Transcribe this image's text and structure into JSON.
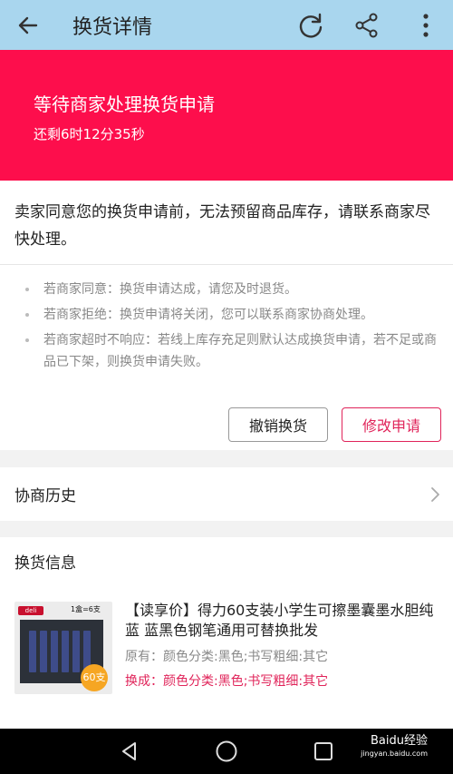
{
  "appbar": {
    "title": "换货详情",
    "icons": [
      "back-arrow-icon",
      "refresh-icon",
      "share-icon",
      "more-vert-icon"
    ]
  },
  "banner": {
    "status": "等待商家处理换货申请",
    "countdown": "还剩6时12分35秒",
    "color": "#fd0e4c"
  },
  "notice": {
    "message": "卖家同意您的换货申请前，无法预留商品库存，请联系商家尽快处理。",
    "rules": [
      "若商家同意：换货申请达成，请您及时退货。",
      "若商家拒绝：换货申请将关闭，您可以联系商家协商处理。",
      "若商家超时不响应：若线上库存充足则默认达成换货申请，若不足或商品已下架，则换货申请失败。"
    ],
    "buttons": {
      "cancel": "撤销换货",
      "modify": "修改申请"
    }
  },
  "history": {
    "label": "协商历史"
  },
  "exchange_info": {
    "heading": "换货信息",
    "product": {
      "title": "【读享价】得力60支装小学生可擦墨囊墨水胆纯蓝 蓝黑色钢笔通用可替换批发",
      "original": "原有：颜色分类:黑色;书写粗细:其它",
      "exchange": "换成：颜色分类:黑色;书写粗细:其它",
      "image_brand": "deli",
      "image_box_label": "1盒=6支",
      "image_badge": "60支"
    }
  },
  "navbar": {
    "icons": [
      "back-triangle-icon",
      "home-circle-icon",
      "recents-square-icon"
    ]
  },
  "watermark": {
    "text": "Baidu经验",
    "url": "jingyan.baidu.com"
  },
  "colors": {
    "accent": "#e0245a",
    "appbar": "#a9d6ee"
  }
}
